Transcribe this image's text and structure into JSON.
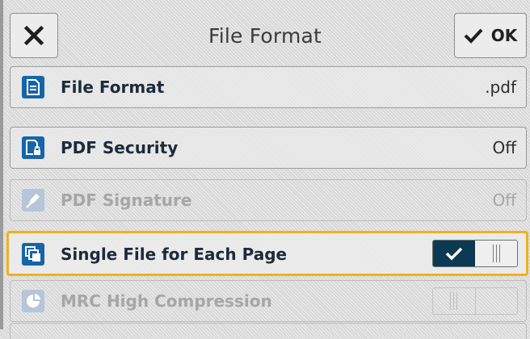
{
  "header": {
    "title": "File Format",
    "ok_label": "OK"
  },
  "settings": [
    {
      "label": "File Format",
      "value": ".pdf"
    },
    {
      "label": "PDF Security",
      "value": "Off"
    },
    {
      "label": "PDF Signature",
      "value": "Off"
    },
    {
      "label": "Single File for Each Page",
      "toggle": "on"
    },
    {
      "label": "MRC High Compression",
      "toggle": "off"
    }
  ],
  "colors": {
    "accent_highlight": "#f2b01d",
    "icon_blue": "#1565a8",
    "toggle_on": "#0c3a52"
  },
  "icons": {
    "close": "close-icon",
    "ok": "check-icon",
    "file_format": "file-format-icon",
    "pdf_security": "pdf-lock-icon",
    "pdf_signature": "pen-icon",
    "single_file": "pages-stack-icon",
    "mrc": "pie-chart-icon"
  }
}
